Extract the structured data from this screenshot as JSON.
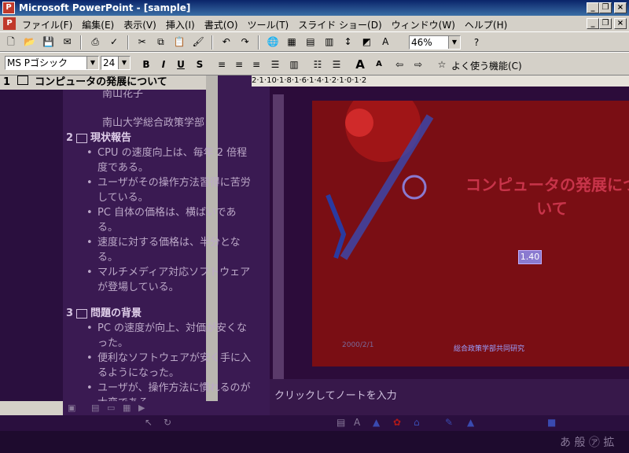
{
  "window": {
    "title": "Microsoft PowerPoint - [sample]",
    "app_icon": "powerpoint-icon"
  },
  "menubar": {
    "items": [
      "ファイル(F)",
      "編集(E)",
      "表示(V)",
      "挿入(I)",
      "書式(O)",
      "ツール(T)",
      "スライド ショー(D)",
      "ウィンドウ(W)",
      "ヘルプ(H)"
    ]
  },
  "standard_toolbar": {
    "zoom": "46%",
    "icons": [
      "new-icon",
      "open-icon",
      "save-icon",
      "email-icon",
      "print-icon",
      "spellcheck-icon",
      "cut-icon",
      "copy-icon",
      "paste-icon",
      "format-painter-icon",
      "undo-icon",
      "redo-icon",
      "hyperlink-icon",
      "table-icon",
      "chart-icon",
      "expand-icon",
      "show-formatting-icon",
      "grayscale-icon",
      "help-icon"
    ]
  },
  "formatting_toolbar": {
    "font": "MS Pゴシック",
    "size": "24",
    "bold": "B",
    "italic": "I",
    "underline": "U",
    "shadow": "S",
    "favorites": "よく使う機能(C)"
  },
  "outline": {
    "slide1_title": "コンピュータの発展について",
    "slide1_num": "1",
    "subtitle": [
      "南山花子",
      "南山大学総合政策学部"
    ],
    "slides": [
      {
        "num": "2",
        "title": "現状報告",
        "bullets": [
          "CPU の速度向上は、毎年 2 倍程度である。",
          "ユーザがその操作方法習得に苦労している。",
          "PC 自体の価格は、横ばいである。",
          "速度に対する価格は、半分となる。",
          "マルチメディア対応ソフトウェアが登場している。"
        ]
      },
      {
        "num": "3",
        "title": "問題の背景",
        "bullets": [
          "PC の速度が向上、対価が安くなった。",
          "便利なソフトウェアが安く手に入るようになった。",
          "ユーザが、操作方法に慣れるのが大変である。"
        ]
      }
    ]
  },
  "ruler": {
    "marks": "2·1·10·1·8·1·6·1·4·1·2·1·0·1·2"
  },
  "slide": {
    "title": "コンピュータの発展について",
    "number_box": "1.40",
    "date_placeholder": "2000/2/1",
    "footer_placeholder": "総合政策学部共同研究"
  },
  "notes": {
    "placeholder": "クリックしてノートを入力"
  },
  "status": {
    "ime": "あ 般 ㋐ 拡"
  }
}
